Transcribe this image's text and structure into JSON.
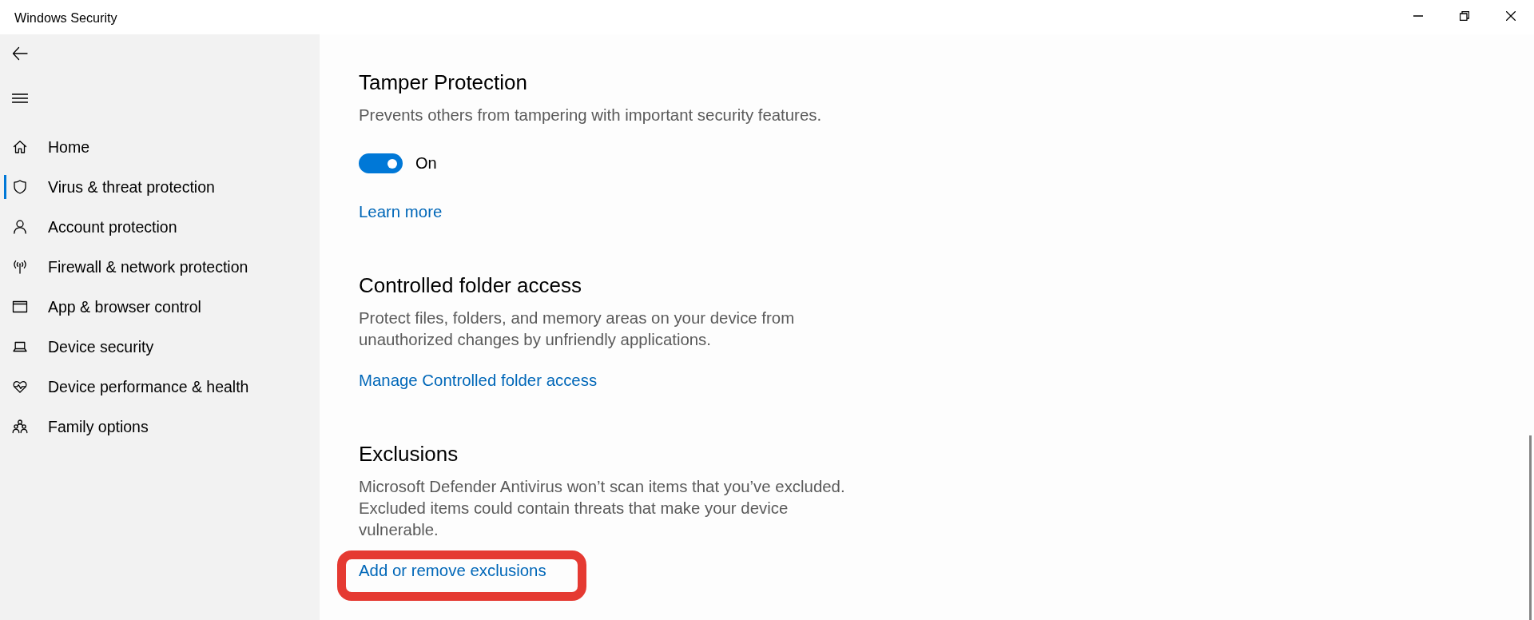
{
  "window": {
    "title": "Windows Security"
  },
  "sidebar": {
    "items": [
      {
        "label": "Home",
        "selected": false
      },
      {
        "label": "Virus & threat protection",
        "selected": true
      },
      {
        "label": "Account protection",
        "selected": false
      },
      {
        "label": "Firewall & network protection",
        "selected": false
      },
      {
        "label": "App & browser control",
        "selected": false
      },
      {
        "label": "Device security",
        "selected": false
      },
      {
        "label": "Device performance & health",
        "selected": false
      },
      {
        "label": "Family options",
        "selected": false
      }
    ]
  },
  "sections": [
    {
      "title": "Tamper Protection",
      "description": "Prevents others from tampering with important security features.",
      "toggle": {
        "on": true,
        "label": "On"
      },
      "link": {
        "text": "Learn more",
        "highlighted": false
      }
    },
    {
      "title": "Controlled folder access",
      "description": "Protect files, folders, and memory areas on your device from unauthorized changes by unfriendly applications.",
      "link": {
        "text": "Manage Controlled folder access",
        "highlighted": false
      }
    },
    {
      "title": "Exclusions",
      "description": "Microsoft Defender Antivirus won’t scan items that you’ve excluded. Excluded items could contain threats that make your device vulnerable.",
      "link": {
        "text": "Add or remove exclusions",
        "highlighted": true
      }
    }
  ]
}
